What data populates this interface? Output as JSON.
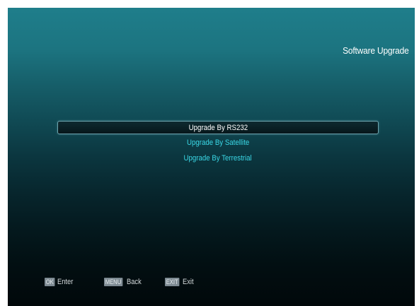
{
  "header": {
    "title": "Software Upgrade"
  },
  "menu": {
    "items": [
      {
        "label": "Upgrade By RS232",
        "selected": true
      },
      {
        "label": "Upgrade By Satellite",
        "selected": false
      },
      {
        "label": "Upgrade By Terrestrial",
        "selected": false
      }
    ]
  },
  "hints": [
    {
      "key": "OK",
      "label": "Enter"
    },
    {
      "key": "MENU",
      "label": "Back"
    },
    {
      "key": "EXIT",
      "label": "Exit"
    }
  ],
  "colors": {
    "background_top": "#1f7e8b",
    "background_bottom": "#01080a",
    "menu_text": "#3ad8e6",
    "selected_text": "#ffffff",
    "key_badge": "#7e8b93"
  }
}
